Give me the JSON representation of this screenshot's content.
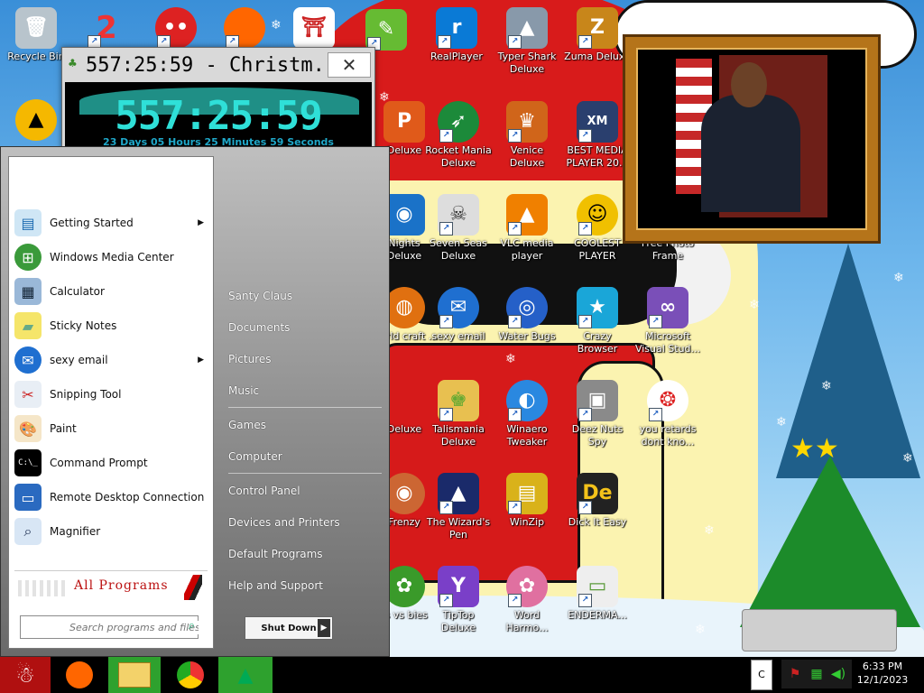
{
  "colors": {
    "taskbar": "#000000",
    "timer_digits": "#2fe0d8",
    "all_programs": "#bb1111"
  },
  "desktop_icons": [
    {
      "id": "recycle",
      "label": "Recycle Bin",
      "icon": "recycle-bin-icon",
      "color": "#9aa"
    },
    {
      "id": "icon-2",
      "label": "",
      "icon": "number-2-icon",
      "color": "#e33"
    },
    {
      "id": "red-ball",
      "label": "",
      "icon": "red-creature-icon",
      "color": "#d22"
    },
    {
      "id": "firefox-top",
      "label": "",
      "icon": "firefox-icon",
      "color": "#f60"
    },
    {
      "id": "gate",
      "label": "",
      "icon": "torii-gate-icon",
      "color": "#c22"
    },
    {
      "id": "notepadpp",
      "label": "Notepad++",
      "icon": "notepad-plus-plus-icon",
      "color": "#6b3"
    },
    {
      "id": "realplayer",
      "label": "RealPlayer",
      "icon": "realplayer-icon",
      "color": "#0a7ad6"
    },
    {
      "id": "typershark",
      "label": "Typer Shark Deluxe",
      "icon": "shark-icon",
      "color": "#8899aa"
    },
    {
      "id": "zuma",
      "label": "Zuma Deluxe",
      "icon": "zuma-icon",
      "color": "#c8861a"
    },
    {
      "id": "aimp",
      "label": "",
      "icon": "aimp-icon",
      "color": "#f5b800"
    },
    {
      "id": "p-deluxe",
      "label": "Deluxe",
      "icon": "p-letter-icon",
      "color": "#e05a1a"
    },
    {
      "id": "rocketmania",
      "label": "Rocket Mania Deluxe",
      "icon": "rocket-icon",
      "color": "#1c8a3a"
    },
    {
      "id": "venice",
      "label": "Venice Deluxe",
      "icon": "venice-icon",
      "color": "#d0651a"
    },
    {
      "id": "xmplay",
      "label": "BEST MEDIA PLAYER 20...",
      "icon": "xmplay-icon",
      "color": "#2a3f6e"
    },
    {
      "id": "arabian",
      "label": "Nights Deluxe",
      "icon": "lamp-icon",
      "color": "#1a72c8"
    },
    {
      "id": "sevenseas",
      "label": "Seven Seas Deluxe",
      "icon": "skull-icon",
      "color": "#ddd"
    },
    {
      "id": "vlc",
      "label": "VLC media player",
      "icon": "vlc-cone-icon",
      "color": "#f08000"
    },
    {
      "id": "coolest",
      "label": "COOLEST PLAYER",
      "icon": "smiley-icon",
      "color": "#f0c000"
    },
    {
      "id": "photoframe",
      "label": "Free Photo Frame",
      "icon": "photo-frame-icon",
      "color": "#888"
    },
    {
      "id": "world",
      "label": "World craft ...",
      "icon": "world-icon",
      "color": "#e07010"
    },
    {
      "id": "sexyemail",
      "label": "sexy email",
      "icon": "thunderbird-icon",
      "color": "#1f6fd0"
    },
    {
      "id": "waterbugs",
      "label": "Water Bugs",
      "icon": "water-bugs-icon",
      "color": "#2560c8"
    },
    {
      "id": "crazybrowser",
      "label": "Crazy Browser",
      "icon": "star-icon",
      "color": "#1aa6d8"
    },
    {
      "id": "vstudio",
      "label": "Microsoft Visual Stud...",
      "icon": "visual-studio-icon",
      "color": "#7a4fb8"
    },
    {
      "id": "deluxe2",
      "label": "Deluxe",
      "icon": "game-icon",
      "color": "#333"
    },
    {
      "id": "talismania",
      "label": "Talismania Deluxe",
      "icon": "talisman-icon",
      "color": "#e8c050"
    },
    {
      "id": "winaero",
      "label": "Winaero Tweaker",
      "icon": "winaero-icon",
      "color": "#2a88e0"
    },
    {
      "id": "deeznuts",
      "label": "Deez Nuts Spy",
      "icon": "windows-stack-icon",
      "color": "#8a8a8a"
    },
    {
      "id": "retards",
      "label": "you retards dont kno...",
      "icon": "red-dragon-icon",
      "color": "#d22"
    },
    {
      "id": "frenzy",
      "label": "Frenzy",
      "icon": "frenzy-icon",
      "color": "#c63"
    },
    {
      "id": "wizardspen",
      "label": "The Wizard's Pen",
      "icon": "wizard-hat-icon",
      "color": "#1a2a6a"
    },
    {
      "id": "winzip",
      "label": "WinZip",
      "icon": "winzip-icon",
      "color": "#d9b21a"
    },
    {
      "id": "dickiteasy",
      "label": "Dick It Easy",
      "icon": "de-logo-icon",
      "color": "#222"
    },
    {
      "id": "zombies",
      "label": "ts vs bies",
      "icon": "plant-icon",
      "color": "#3a9a2a"
    },
    {
      "id": "tiptop",
      "label": "TipTop Deluxe",
      "icon": "cocktail-icon",
      "color": "#7a3fc8"
    },
    {
      "id": "wordharmony",
      "label": "Word Harmo...",
      "icon": "flower-icon",
      "color": "#e070a0"
    },
    {
      "id": "enderman",
      "label": "ENDERMA...",
      "icon": "window-app-icon",
      "color": "#5a9a3a"
    }
  ],
  "timer": {
    "title": "557:25:59 - Christm...",
    "big": "557:25:59",
    "small": "23 Days 05 Hours 25 Minutes 59 Seconds",
    "close": "✕"
  },
  "start_menu": {
    "left_items": [
      {
        "label": "Getting Started",
        "icon": "getting-started-icon",
        "sub": true
      },
      {
        "label": "Windows Media Center",
        "icon": "windows-media-center-icon",
        "sub": false
      },
      {
        "label": "Calculator",
        "icon": "calculator-icon",
        "sub": false
      },
      {
        "label": "Sticky Notes",
        "icon": "sticky-notes-icon",
        "sub": false
      },
      {
        "label": "sexy email",
        "icon": "thunderbird-icon",
        "sub": true
      },
      {
        "label": "Snipping Tool",
        "icon": "scissors-icon",
        "sub": false
      },
      {
        "label": "Paint",
        "icon": "paint-palette-icon",
        "sub": false
      },
      {
        "label": "Command Prompt",
        "icon": "command-prompt-icon",
        "sub": false
      },
      {
        "label": "Remote Desktop Connection",
        "icon": "remote-desktop-icon",
        "sub": false
      },
      {
        "label": "Magnifier",
        "icon": "magnifier-icon",
        "sub": false
      }
    ],
    "all_programs": "All Programs",
    "search_placeholder": "Search programs and files",
    "right_items": [
      "Santy Claus",
      "Documents",
      "Pictures",
      "Music",
      "Games",
      "Computer",
      "Control Panel",
      "Devices and Printers",
      "Default Programs",
      "Help and Support"
    ],
    "shutdown": "Shut Down"
  },
  "taskbar": {
    "buttons": [
      {
        "name": "start-button",
        "icon": "santa-icon"
      },
      {
        "name": "taskbar-firefox",
        "icon": "firefox-icon"
      },
      {
        "name": "taskbar-explorer",
        "icon": "folder-icon"
      },
      {
        "name": "taskbar-chrome",
        "icon": "chrome-icon"
      },
      {
        "name": "taskbar-christmas-tree",
        "icon": "christmas-tree-icon"
      }
    ],
    "tray_box": "C",
    "time": "6:33 PM",
    "date": "12/1/2023"
  }
}
